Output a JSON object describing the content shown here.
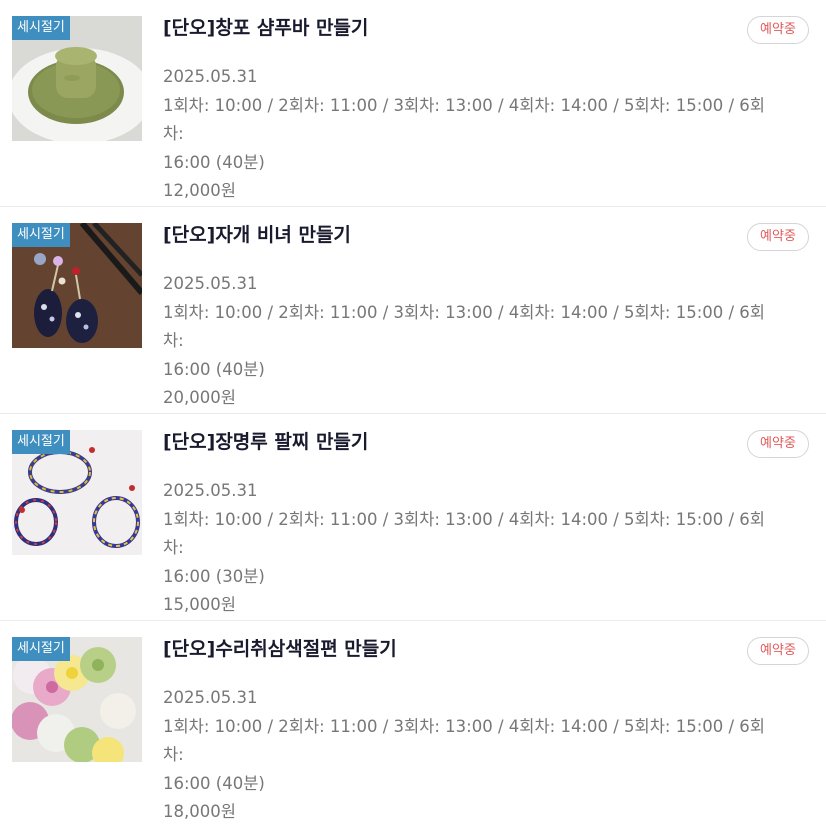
{
  "items": [
    {
      "tag": "세시절기",
      "title": "[단오]창포 샴푸바 만들기",
      "status": "예약중",
      "date": "2025.05.31",
      "schedule_line1": "1회차: 10:00 / 2회차: 11:00 / 3회차: 13:00 / 4회차: 14:00 / 5회차: 15:00 / 6회차:",
      "schedule_line2": "16:00 (40분)",
      "price": "12,000원"
    },
    {
      "tag": "세시절기",
      "title": "[단오]자개 비녀 만들기",
      "status": "예약중",
      "date": "2025.05.31",
      "schedule_line1": "1회차: 10:00 / 2회차: 11:00 / 3회차: 13:00 / 4회차: 14:00 / 5회차: 15:00 / 6회차:",
      "schedule_line2": "16:00 (40분)",
      "price": "20,000원"
    },
    {
      "tag": "세시절기",
      "title": "[단오]장명루 팔찌 만들기",
      "status": "예약중",
      "date": "2025.05.31",
      "schedule_line1": "1회차: 10:00 / 2회차: 11:00 / 3회차: 13:00 / 4회차: 14:00 / 5회차: 15:00 / 6회차:",
      "schedule_line2": "16:00 (30분)",
      "price": "15,000원"
    },
    {
      "tag": "세시절기",
      "title": "[단오]수리취삼색절편 만들기",
      "status": "예약중",
      "date": "2025.05.31",
      "schedule_line1": "1회차: 10:00 / 2회차: 11:00 / 3회차: 13:00 / 4회차: 14:00 / 5회차: 15:00 / 6회차:",
      "schedule_line2": "16:00 (40분)",
      "price": "18,000원"
    }
  ],
  "colors": {
    "tag_bg": "#3e8ec0",
    "status_text": "#e05a5a",
    "title_text": "#1a1a2e",
    "meta_text": "#777777"
  }
}
